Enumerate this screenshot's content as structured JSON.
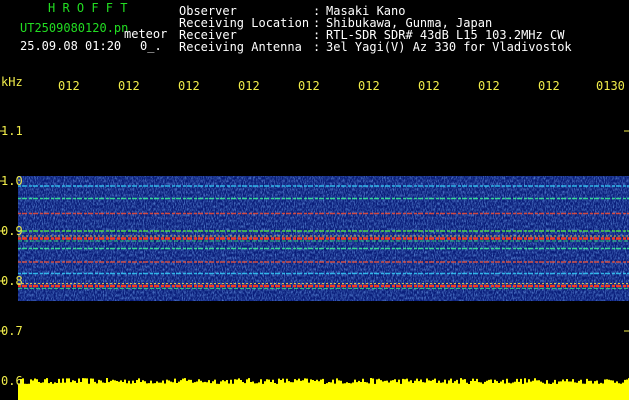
{
  "header": {
    "brand": "H R O F F T",
    "filename": "UT2509080120.pn",
    "subtitle": "meteor",
    "datetime": "25.09.08 01:20",
    "extra": "0_.",
    "labels": [
      "Observer",
      "Receiving Location",
      "Receiver",
      "Receiving Antenna"
    ],
    "colons": [
      ":",
      ":",
      ":",
      ":"
    ],
    "values": [
      "Masaki Kano",
      "Shibukawa, Gunma, Japan",
      "RTL-SDR SDR# 43dB L15 103.2MHz CW",
      "3el Yagi(V) Az 330 for Vladivostok"
    ]
  },
  "axis": {
    "unit": "kHz",
    "time_ticks": [
      "012",
      "012",
      "012",
      "012",
      "012",
      "012",
      "012",
      "012",
      "012",
      "0130"
    ],
    "freq_ticks": [
      "1.1",
      "1.0",
      "0.9",
      "0.8",
      "0.7",
      "0.6"
    ]
  },
  "colors": {
    "background": "#000000",
    "text_green": "#22dd22",
    "text_white": "#ffffff",
    "axis_yellow": "#f0ec4a",
    "spectrogram_base": "#0a1e7a",
    "noise_bar": "#ffff00"
  },
  "chart_data": {
    "type": "heatmap",
    "xlabel": "",
    "ylabel": "kHz",
    "ylim": [
      0.6,
      1.2
    ],
    "y_ticks": [
      1.1,
      1.0,
      0.9,
      0.8,
      0.7,
      0.6
    ],
    "signal_band": [
      0.76,
      1.01
    ],
    "carrier_lines_khz": [
      0.99,
      0.965,
      0.935,
      0.9,
      0.885,
      0.865,
      0.838,
      0.815,
      0.79
    ]
  }
}
